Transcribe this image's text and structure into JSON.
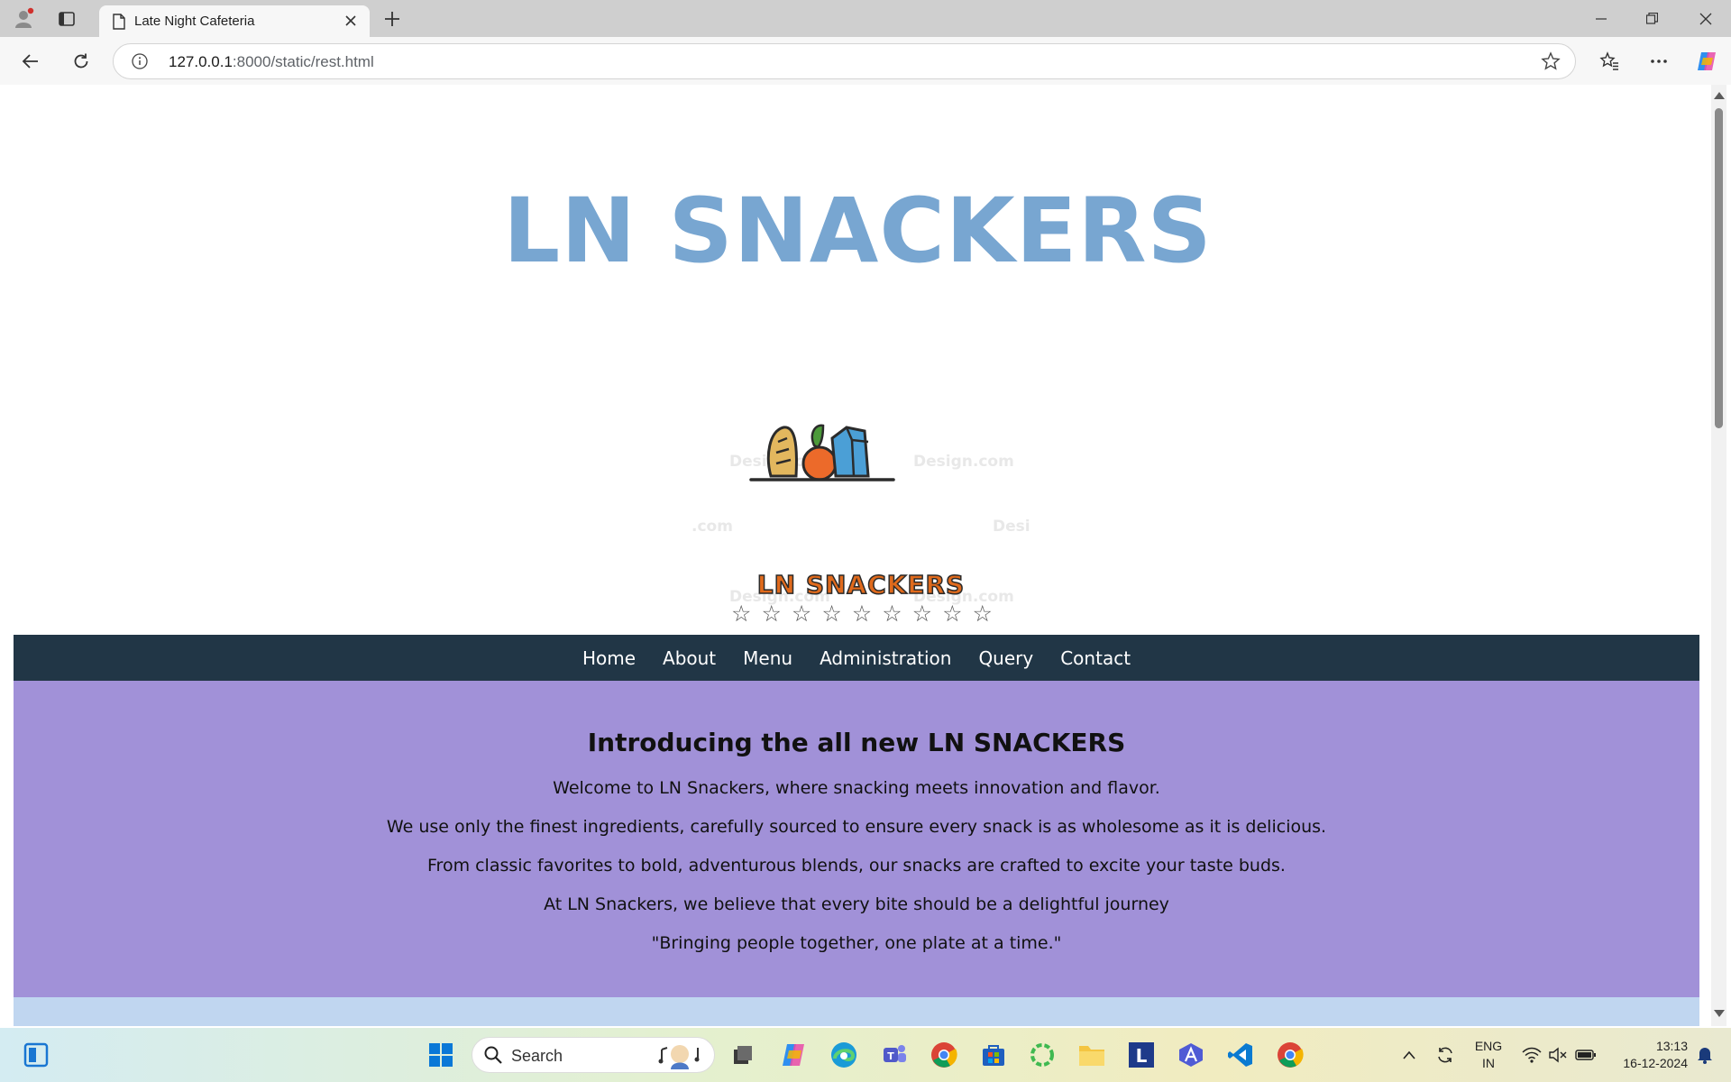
{
  "browser": {
    "tab_title": "Late Night Cafeteria",
    "url_host": "127.0.0.1",
    "url_rest": ":8000/static/rest.html"
  },
  "page": {
    "site_title": "LN SNACKERS",
    "logo": {
      "brand_text": "LN SNACKERS",
      "watermark_text": "Design.com",
      "watermark_fragment_a": ".com",
      "watermark_fragment_b": "Desi",
      "stars_count": 9
    },
    "nav": [
      {
        "label": "Home"
      },
      {
        "label": "About"
      },
      {
        "label": "Menu"
      },
      {
        "label": "Administration"
      },
      {
        "label": "Query"
      },
      {
        "label": "Contact"
      }
    ],
    "intro": {
      "heading": "Introducing the all new LN SNACKERS",
      "lines": [
        "Welcome to LN Snackers, where snacking meets innovation and flavor.",
        "We use only the finest ingredients, carefully sourced to ensure every snack is as wholesome as it is delicious.",
        "From classic favorites to bold, adventurous blends, our snacks are crafted to excite your taste buds.",
        "At LN Snackers, we believe that every bite should be a delightful journey",
        "\"Bringing people together, one plate at a time.\""
      ]
    },
    "colors": {
      "title": "#78a6d1",
      "navbar": "#213646",
      "intro_bg": "#a191d8",
      "next_section_bg": "#c0d6f0"
    }
  },
  "taskbar": {
    "search_placeholder": "Search",
    "lang_top": "ENG",
    "lang_bottom": "IN",
    "time": "13:13",
    "date": "16-12-2024",
    "apps": [
      "windows-start",
      "file-manager",
      "copilot",
      "edge",
      "teams",
      "chrome",
      "store",
      "green-app",
      "file-explorer",
      "l-app",
      "a-app",
      "vscode",
      "chrome-2"
    ]
  }
}
